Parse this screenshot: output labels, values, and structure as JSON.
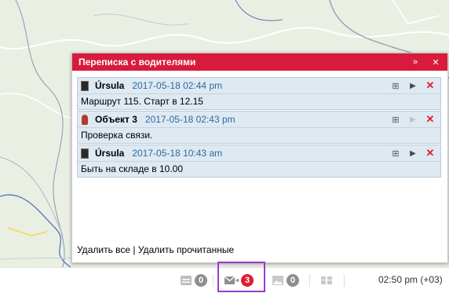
{
  "dialog": {
    "title": "Переписка с водителями",
    "collapse_icon": "double-chevron-up-icon",
    "close_icon": "close-icon",
    "messages": [
      {
        "sender": "Úrsula",
        "date": "2017-05-18 02:44 pm",
        "text": "Маршрут 115. Старт в 12.15",
        "icon": "driver-avatar-icon",
        "play_enabled": true
      },
      {
        "sender": "Объект 3",
        "date": "2017-05-18 02:43 pm",
        "text": "Проверка связи.",
        "icon": "fire-extinguisher-icon",
        "play_enabled": false
      },
      {
        "sender": "Úrsula",
        "date": "2017-05-18 10:43 am",
        "text": "Быть на складе в 10.00",
        "icon": "driver-avatar-icon",
        "play_enabled": true
      }
    ],
    "footer": {
      "delete_all": "Удалить все",
      "separator": "|",
      "delete_read": "Удалить прочитанные"
    }
  },
  "statusbar": {
    "items": [
      {
        "icon": "notifications-icon",
        "count": "0"
      },
      {
        "icon": "driver-messages-icon",
        "count": "3"
      },
      {
        "icon": "images-icon",
        "count": "0"
      },
      {
        "icon": "columns-icon"
      }
    ],
    "time": "02:50 pm (+03)"
  },
  "colors": {
    "header": "#d81b3c",
    "message_bg": "#dfe9f1",
    "date": "#2a6ba8",
    "highlight": "#9b3ad4",
    "badge_red": "#e01b35",
    "badge_grey": "#8e8e8e"
  }
}
